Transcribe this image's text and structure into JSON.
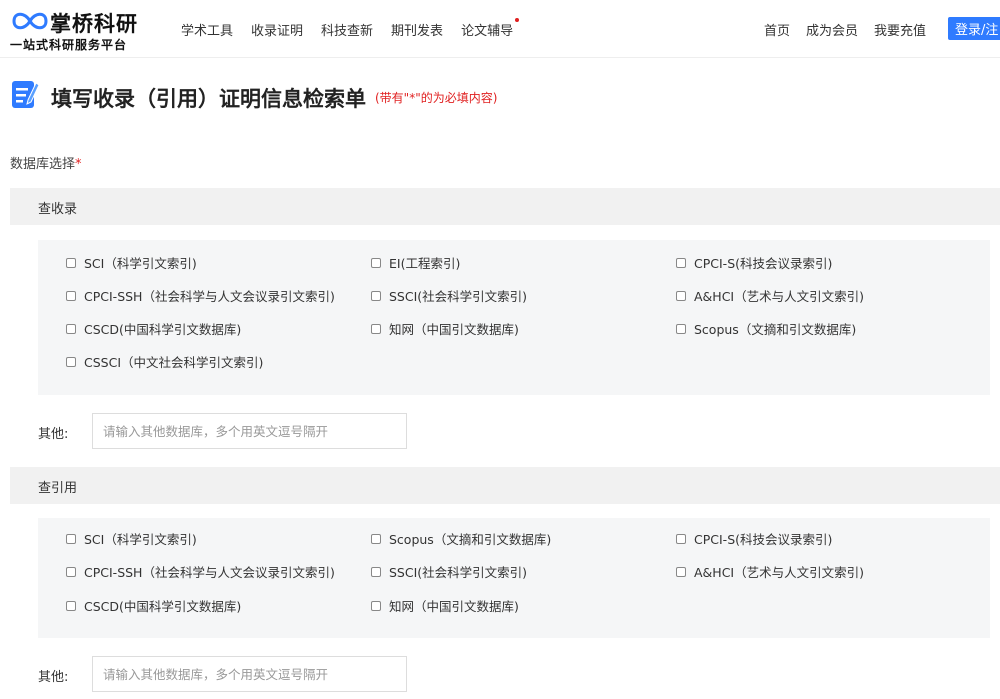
{
  "logo": {
    "title": "掌桥科研",
    "subtitle": "一站式科研服务平台"
  },
  "nav": [
    "学术工具",
    "收录证明",
    "科技查新",
    "期刊发表",
    "论文辅导"
  ],
  "nav_right": [
    "首页",
    "成为会员",
    "我要充值"
  ],
  "login_label": "登录/注",
  "page": {
    "title": "填写收录（引用）证明信息检索单",
    "note": "(带有\"*\"的为必填内容)",
    "db_label": "数据库选择",
    "required_mark": "*"
  },
  "sections": [
    {
      "heading": "查收录",
      "options": [
        "SCI（科学引文索引)",
        "EI(工程索引)",
        "CPCI-S(科技会议录索引)",
        "CPCI-SSH（社会科学与人文会议录引文索引)",
        "SSCI(社会科学引文索引)",
        "A&HCI（艺术与人文引文索引)",
        "CSCD(中国科学引文数据库)",
        "知网（中国引文数据库)",
        "Scopus（文摘和引文数据库)",
        "CSSCI（中文社会科学引文索引)"
      ],
      "other_label": "其他:",
      "other_placeholder": "请输入其他数据库，多个用英文逗号隔开"
    },
    {
      "heading": "查引用",
      "options": [
        "SCI（科学引文索引)",
        "Scopus（文摘和引文数据库)",
        "CPCI-S(科技会议录索引)",
        "CPCI-SSH（社会科学与人文会议录引文索引)",
        "SSCI(社会科学引文索引)",
        "A&HCI（艺术与人文引文索引)",
        "CSCD(中国科学引文数据库)",
        "知网（中国引文数据库)"
      ],
      "other_label": "其他:",
      "other_placeholder": "请输入其他数据库，多个用英文逗号隔开"
    }
  ],
  "colors": {
    "accent": "#2f7bff",
    "required": "#e02020",
    "section_bg": "#f1f1f1",
    "box_bg": "#f5f6f7"
  }
}
